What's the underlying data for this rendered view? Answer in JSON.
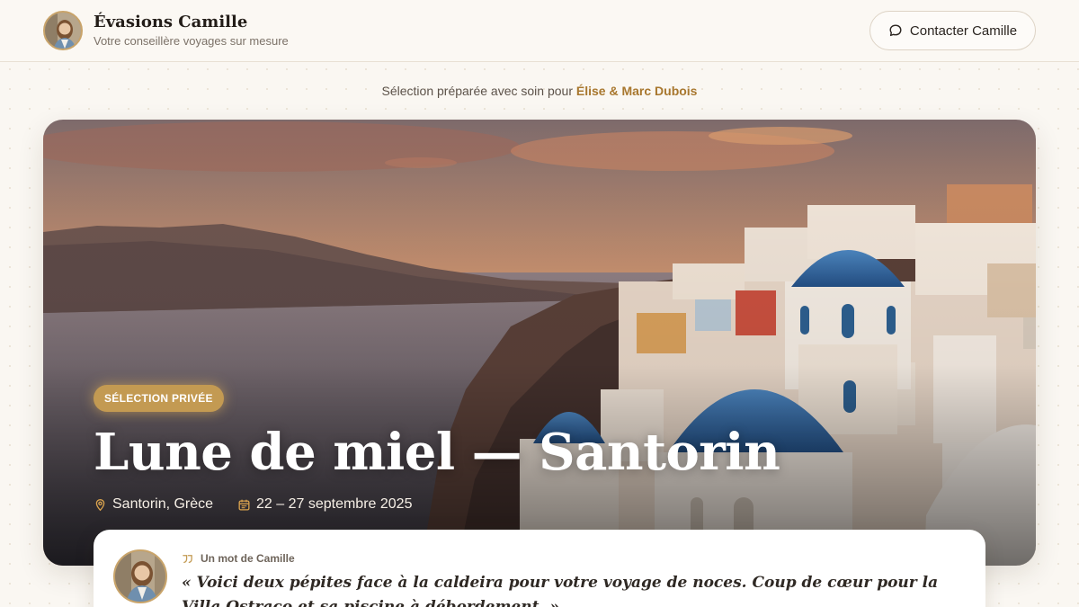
{
  "header": {
    "brand_name": "Évasions Camille",
    "tagline": "Votre conseillère voyages sur mesure",
    "contact_label": "Contacter Camille",
    "contact_icon": "chat-bubble-icon"
  },
  "selection": {
    "prefix": "Sélection préparée avec soin pour ",
    "names": "Élise & Marc Dubois"
  },
  "hero": {
    "badge": "SÉLECTION PRIVÉE",
    "title": "Lune de miel — Santorin",
    "location": "Santorin, Grèce",
    "location_icon": "map-pin-icon",
    "dates": "22 – 27 septembre 2025",
    "dates_icon": "calendar-icon"
  },
  "note": {
    "label": "Un mot de Camille",
    "label_icon": "quote-icon",
    "quote": "« Voici deux pépites face à la caldeira pour votre voyage de noces. Coup de cœur pour la Villa Ostraco et sa piscine à débordement. »"
  },
  "colors": {
    "accent": "#a8772e",
    "badge": "#c39a52",
    "background": "#faf7f2"
  }
}
